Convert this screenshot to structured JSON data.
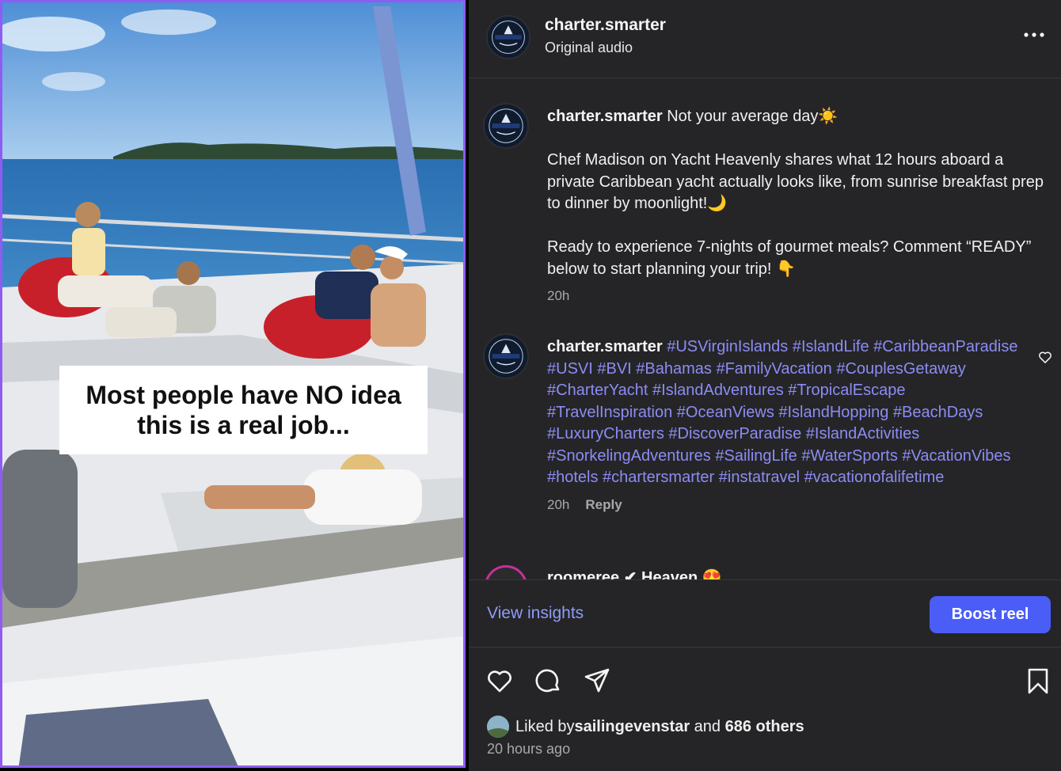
{
  "media": {
    "overlay_caption": "Most people have NO idea\nthis is a real job..."
  },
  "header": {
    "username": "charter.smarter",
    "audio": "Original audio",
    "more_icon": "more-horizontal-icon"
  },
  "comments": [
    {
      "username": "charter.smarter",
      "text": " Not your average day☀️\n\nChef Madison on Yacht Heavenly shares what 12 hours aboard a private Caribbean yacht actually looks like, from sunrise breakfast prep to dinner by moonlight!🌙\n\nReady to experience 7-nights of gourmet meals? Comment “READY” below to start planning your trip! 👇",
      "time": "20h"
    },
    {
      "username": "charter.smarter",
      "hashtags": "#USVirginIslands #IslandLife #CaribbeanParadise #USVI #BVI #Bahamas #FamilyVacation #CouplesGetaway #CharterYacht #IslandAdventures #TropicalEscape #TravelInspiration #OceanViews #IslandHopping #BeachDays #LuxuryCharters #DiscoverParadise #IslandActivities #SnorkelingAdventures #SailingLife #WaterSports #VacationVibes #hotels #chartersmarter #instatravel #vacationofalifetime",
      "time": "20h",
      "reply": "Reply"
    }
  ],
  "partial_comment": {
    "text": "roomeree ✔ Heaven 😍"
  },
  "actions": {
    "view_insights": "View insights",
    "boost": "Boost reel"
  },
  "likes": {
    "prefix": "Liked by ",
    "user": "sailingevenstar",
    "middle": " and ",
    "count": "686 others"
  },
  "timestamp": "20 hours ago",
  "colors": {
    "panel_bg": "#252527",
    "link": "#8e9cf8",
    "hashtag": "#8c8cf5",
    "boost": "#4a5df7",
    "media_border": "#8e5cf2"
  }
}
